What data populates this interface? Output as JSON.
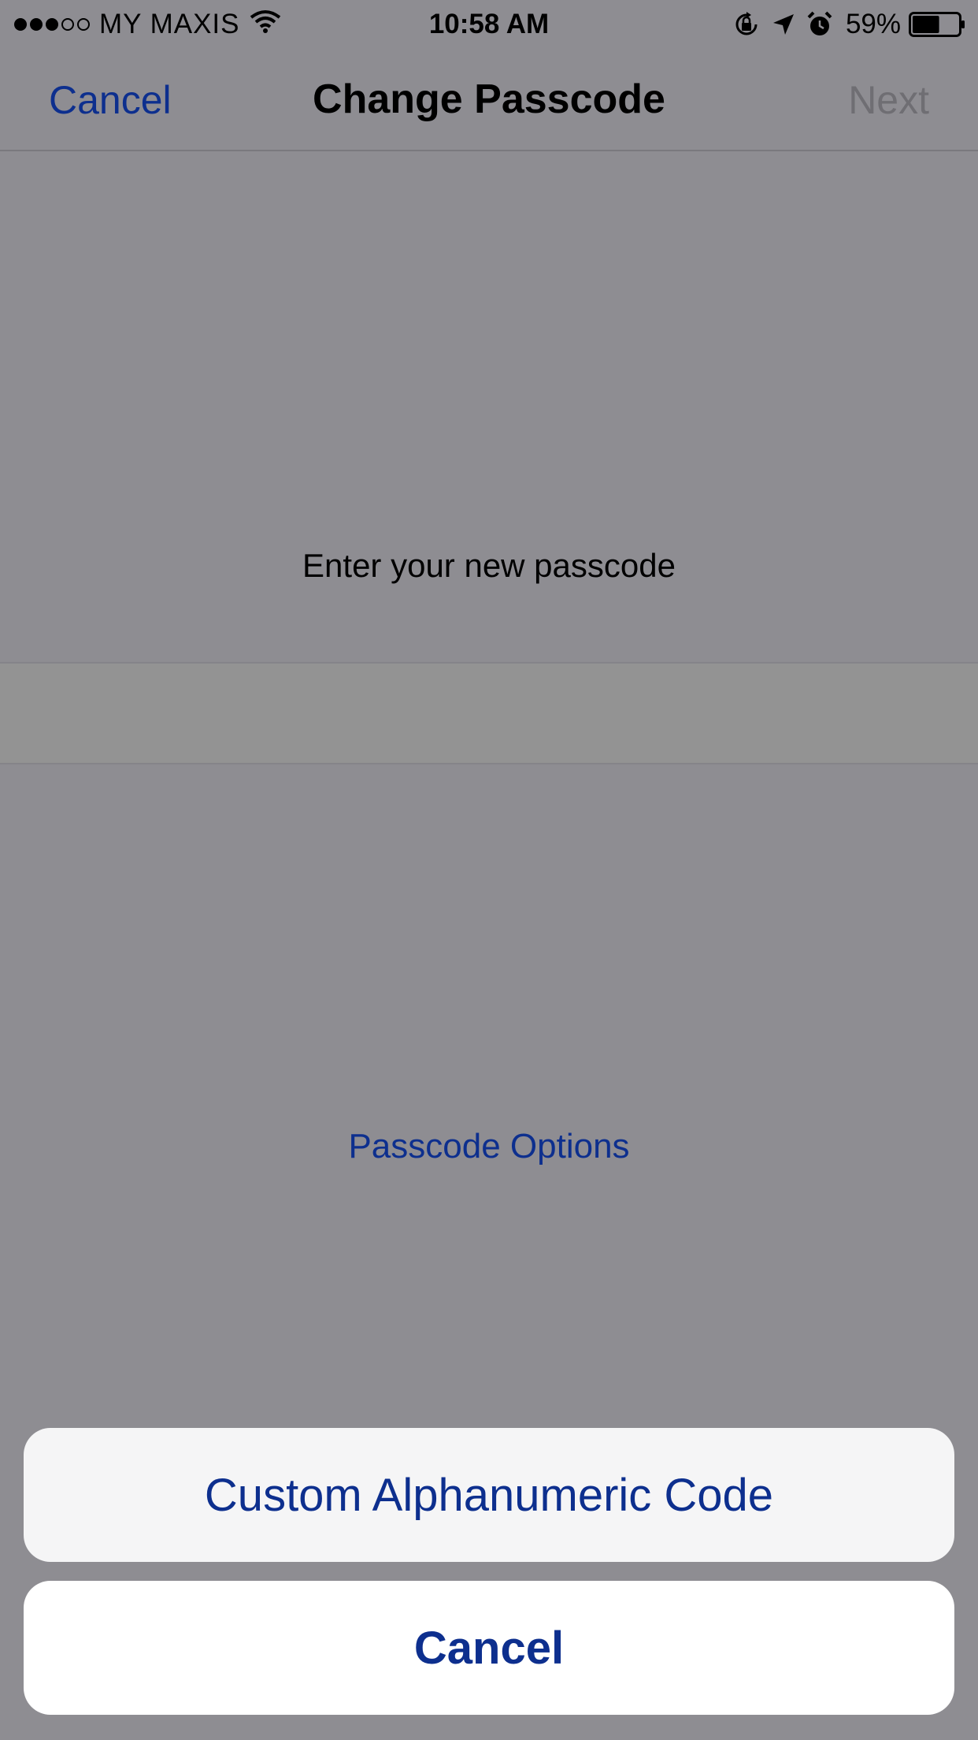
{
  "status_bar": {
    "signal_filled": 3,
    "signal_total": 5,
    "carrier": "MY MAXIS",
    "time": "10:58 AM",
    "battery_percent": "59%",
    "battery_level": 0.59,
    "icons": [
      "wifi-icon",
      "orientation-lock-icon",
      "location-arrow-icon",
      "alarm-icon",
      "battery-icon"
    ]
  },
  "nav": {
    "cancel_label": "Cancel",
    "title": "Change Passcode",
    "next_label": "Next"
  },
  "main": {
    "prompt": "Enter your new passcode",
    "options_link": "Passcode Options"
  },
  "action_sheet": {
    "option_label": "Custom Alphanumeric Code",
    "cancel_label": "Cancel"
  },
  "colors": {
    "overlay_background": "#8e8d92",
    "link_blue": "#0d2f8e",
    "disabled_text": "#6f6e73"
  }
}
